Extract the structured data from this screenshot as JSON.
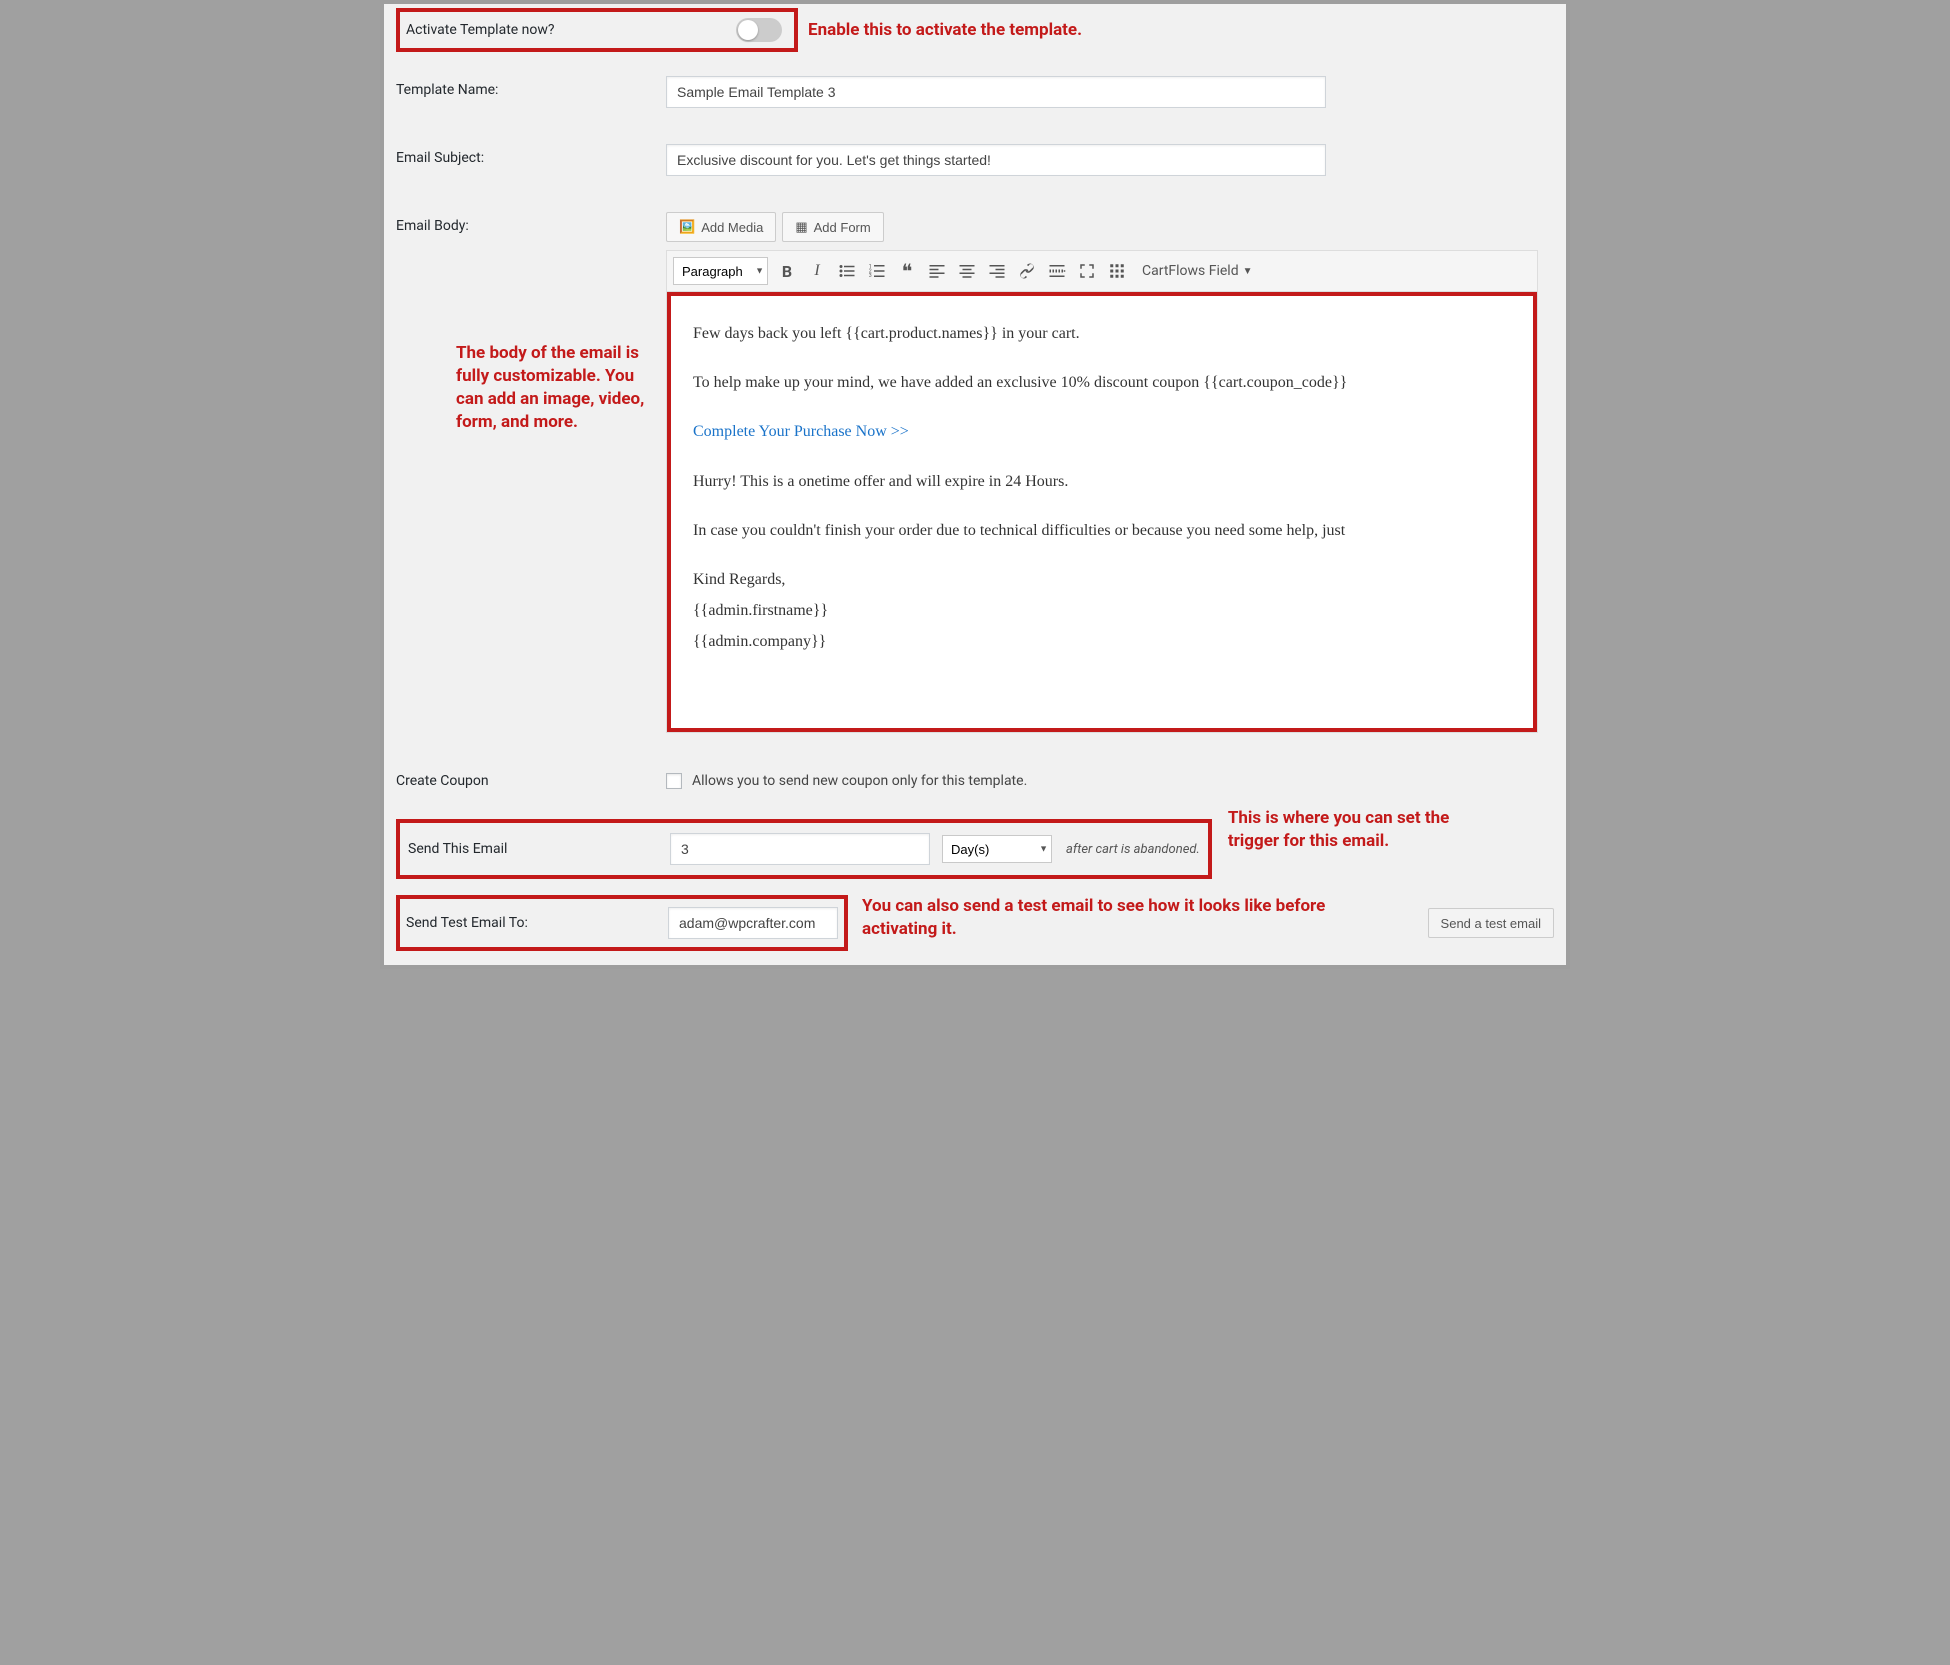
{
  "activate": {
    "label": "Activate Template now?",
    "annotation": "Enable this to activate the template."
  },
  "template_name": {
    "label": "Template Name:",
    "value": "Sample Email Template 3"
  },
  "email_subject": {
    "label": "Email Subject:",
    "value": "Exclusive discount for you. Let's get things started!"
  },
  "email_body": {
    "label": "Email Body:",
    "add_media_btn": "Add Media",
    "add_form_btn": "Add Form",
    "format_select": "Paragraph",
    "cartflows_dd": "CartFlows Field",
    "annotation": "The body of the email is fully customizable. You can add an image, video, form, and more.",
    "content": {
      "line1": "Few days back you left {{cart.product.names}} in your cart.",
      "line2": "To help make up your mind, we have added an exclusive 10% discount coupon {{cart.coupon_code}}",
      "cta": "Complete Your Purchase Now >>",
      "line3": "Hurry! This is a onetime offer and will expire in 24 Hours.",
      "line4": "In case you couldn't finish your order due to technical difficulties or because you need some help, just",
      "sign1": "Kind Regards,",
      "sign2": "{{admin.firstname}}",
      "sign3": "{{admin.company}}"
    }
  },
  "create_coupon": {
    "label": "Create Coupon",
    "desc": "Allows you to send new coupon only for this template."
  },
  "send_this_email": {
    "label": "Send This Email",
    "value": "3",
    "unit": "Day(s)",
    "suffix": "after cart is abandoned.",
    "annotation": "This is where you can set the trigger for this email."
  },
  "send_test": {
    "label": "Send Test Email To:",
    "value": "adam@wpcrafter.com",
    "btn": "Send a test email",
    "annotation": "You can also send a test email to see how it looks like before activating it."
  }
}
